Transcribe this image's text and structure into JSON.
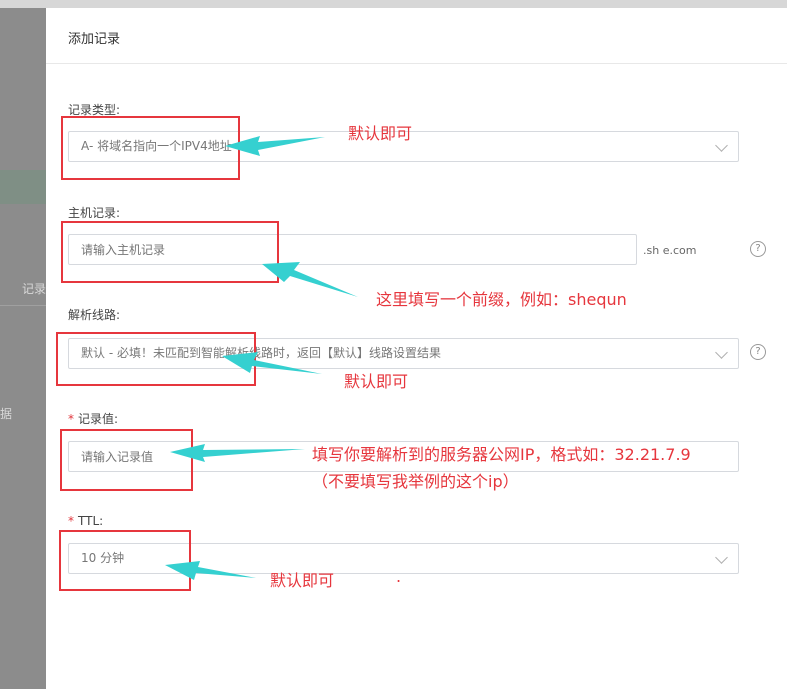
{
  "background": {
    "left_label_1": "记录",
    "left_label_2": "据"
  },
  "dialog": {
    "title": "添加记录",
    "record_type": {
      "label": "记录类型:",
      "value": "A- 将域名指向一个IPV4地址"
    },
    "host_record": {
      "label": "主机记录:",
      "placeholder": "请输入主机记录",
      "suffix": ".sh          e.com"
    },
    "resolve_line": {
      "label": "解析线路:",
      "value": "默认 - 必填！未匹配到智能解析线路时，返回【默认】线路设置结果"
    },
    "record_value": {
      "required": "*",
      "label": "记录值:",
      "placeholder": "请输入记录值"
    },
    "ttl": {
      "required": "*",
      "label": "TTL:",
      "value": "10 分钟"
    },
    "help_icon": "?"
  },
  "annotations": {
    "note1": "默认即可",
    "note2": "这里填写一个前缀，例如：shequn",
    "note3": "默认即可",
    "note4_line1": "填写你要解析到的服务器公网IP，格式如：32.21.7.9",
    "note4_line2": "（不要填写我举例的这个ip）",
    "note5": "默认即可",
    "note5_dot": "."
  },
  "colors": {
    "annotation_red": "#e6363d",
    "arrow_cyan": "#35d0d0"
  }
}
